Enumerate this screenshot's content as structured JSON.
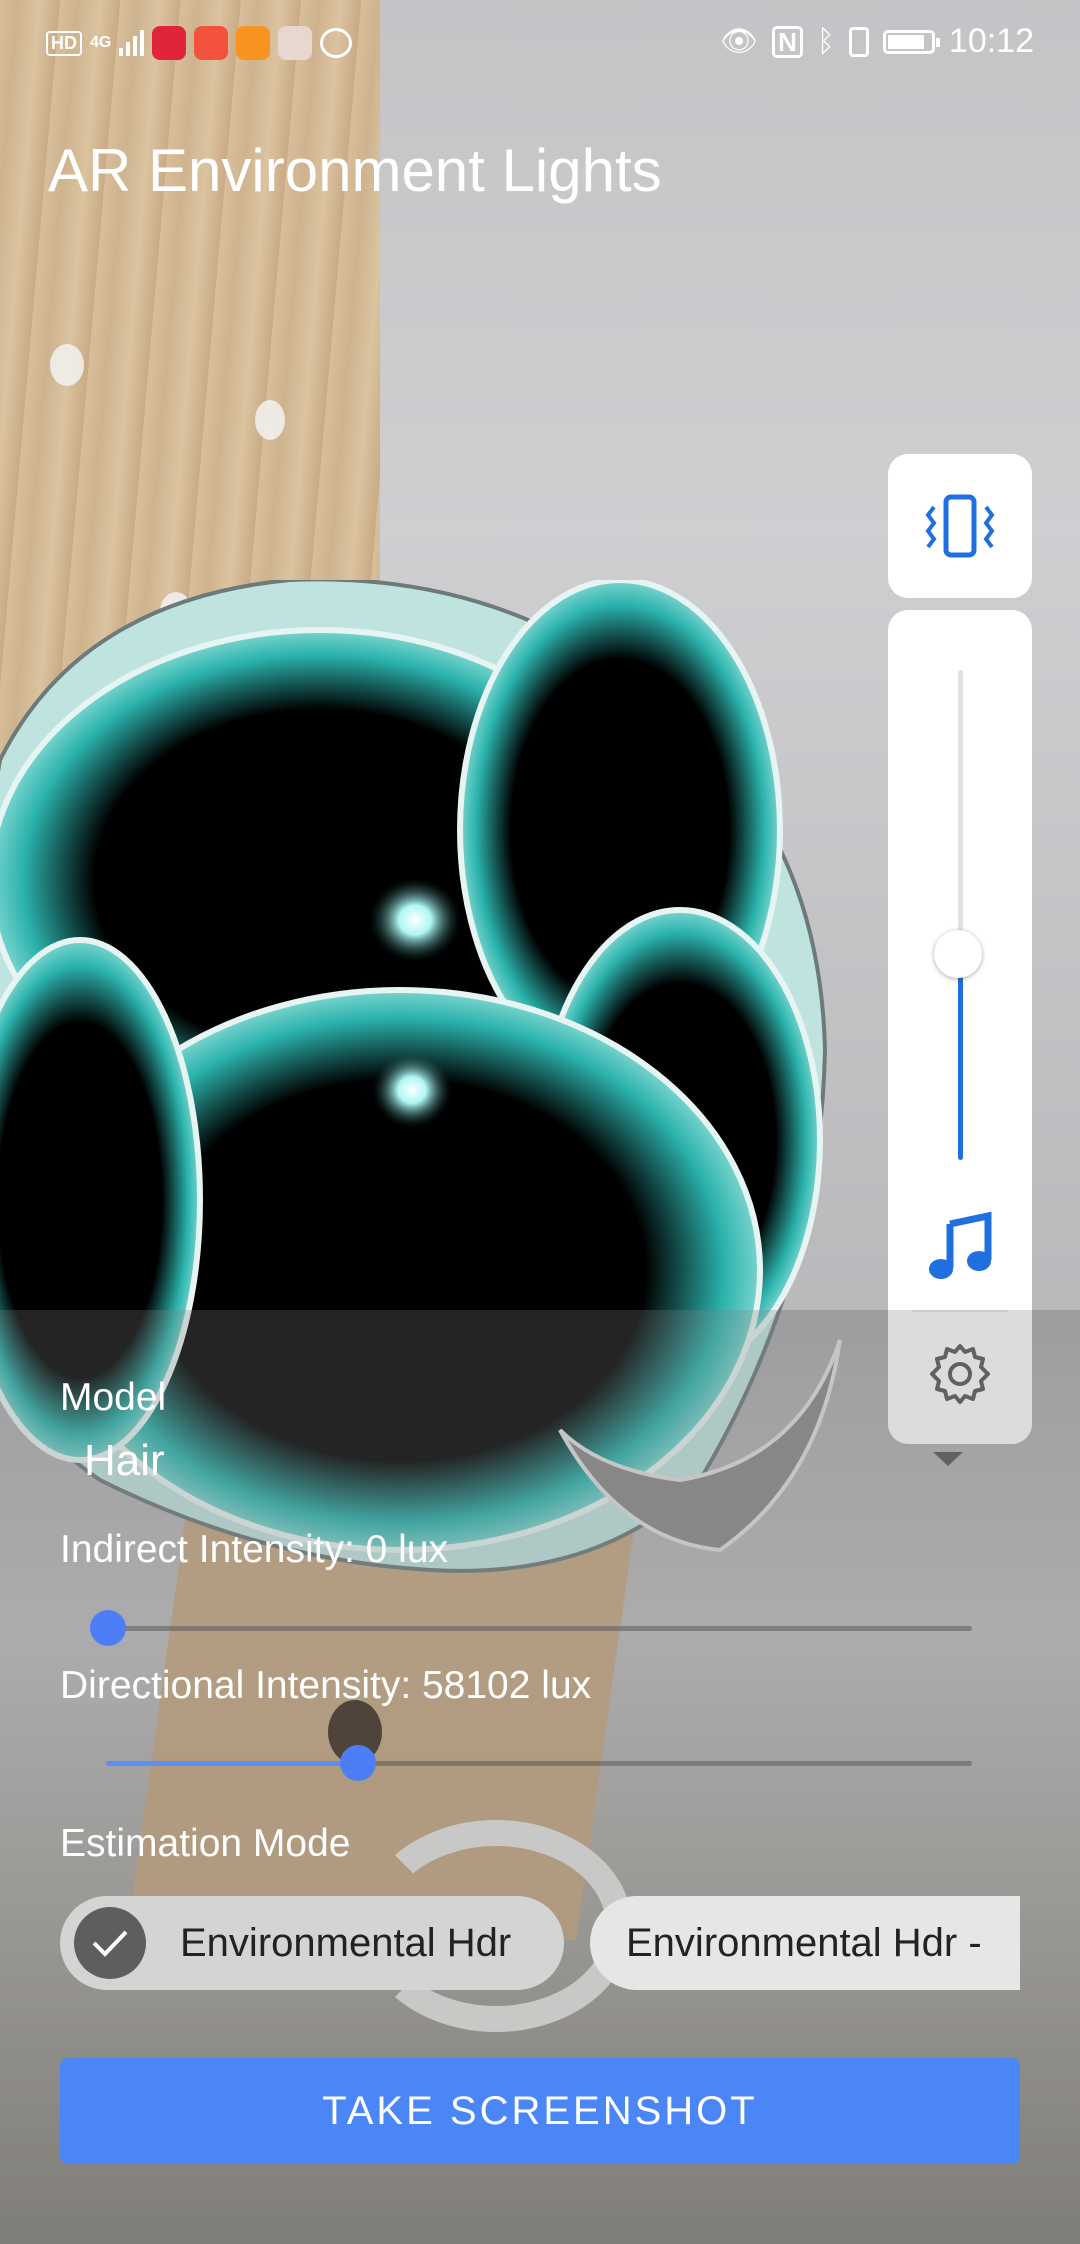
{
  "status_bar": {
    "hd_badge": "HD",
    "network": "4G",
    "time": "10:12",
    "icons": [
      "eye-icon",
      "nfc-icon",
      "bluetooth-icon",
      "vibrate-icon",
      "battery-icon"
    ]
  },
  "app": {
    "title": "AR Environment Lights"
  },
  "volume_panel": {
    "mode_icon": "vibrate-icon",
    "media_icon": "music-note-icon",
    "settings_icon": "gear-icon",
    "level": 0.42,
    "accent": "#1f6fe0"
  },
  "controls": {
    "model_label": "Model",
    "model_value": "Hair",
    "indirect_label": "Indirect Intensity: 0 lux",
    "indirect_level": 0.0,
    "directional_label": "Directional Intensity: 58102 lux",
    "directional_level": 0.29,
    "estimation_label": "Estimation Mode",
    "chips": [
      {
        "label": "Environmental Hdr",
        "selected": true
      },
      {
        "label": "Environmental Hdr -",
        "selected": false
      }
    ],
    "screenshot_button": "TAKE SCREENSHOT",
    "accent": "#4a86f6"
  }
}
